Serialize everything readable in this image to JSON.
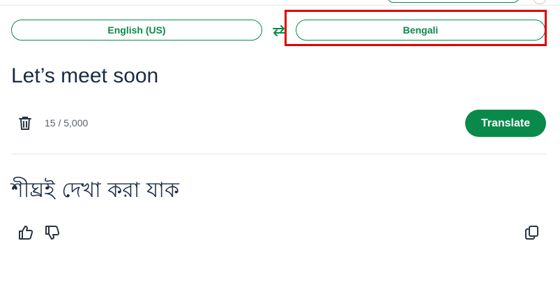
{
  "languages": {
    "source": "English (US)",
    "target": "Bengali"
  },
  "input": {
    "text": "Let’s meet soon",
    "char_count": "15 / 5,000"
  },
  "actions": {
    "translate_label": "Translate"
  },
  "output": {
    "text": "শীঘ্রই দেখা করা যাক"
  },
  "icons": {
    "swap": "swap-arrows-icon",
    "trash": "trash-icon",
    "thumb_up": "thumbs-up-icon",
    "thumb_down": "thumbs-down-icon",
    "copy": "copy-icon"
  },
  "colors": {
    "accent": "#0a8a4a",
    "highlight": "#e00000",
    "text": "#1b2b44"
  }
}
